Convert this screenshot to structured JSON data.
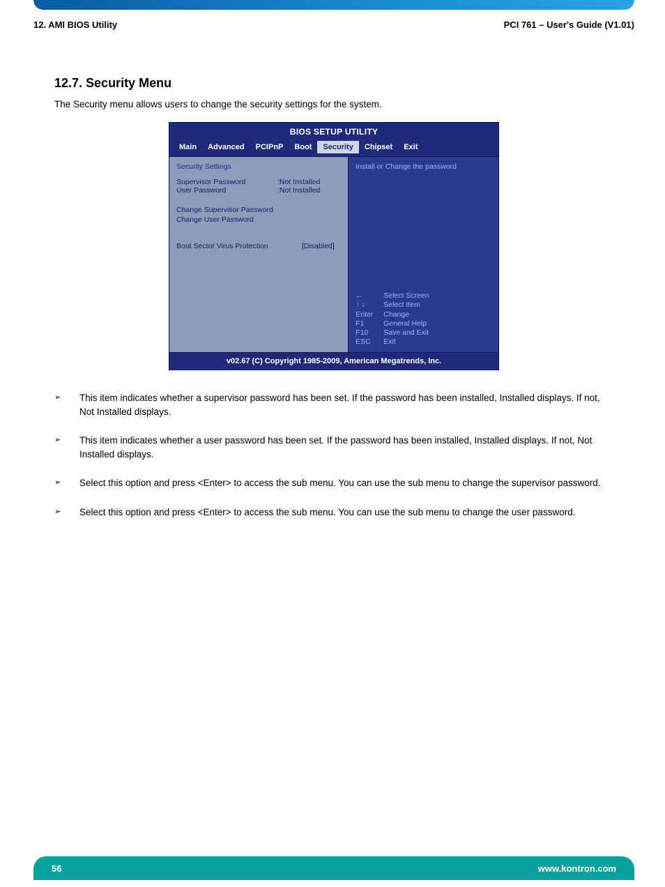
{
  "header": {
    "left": "12. AMI BIOS Utility",
    "right": "PCI 761 – User's Guide (V1.01)"
  },
  "section": {
    "title": "12.7. Security Menu",
    "intro": "The Security menu allows users to change the security settings for the system."
  },
  "bios": {
    "title": "BIOS SETUP UTILITY",
    "tabs": {
      "main": "Main",
      "advanced": "Advanced",
      "pcipnp": "PCIPnP",
      "boot": "Boot",
      "security": "Security",
      "chipset": "Chipset",
      "exit": "Exit"
    },
    "left": {
      "heading": "Security Settings",
      "supervisor_label": "Supervisor Password",
      "supervisor_value": ":Not Installed",
      "user_label": "User Password",
      "user_value": ":Not Installed",
      "change_sup": "Change Supervisor Password",
      "change_user": "Change User Password",
      "bootsector_label": "Boot Sector Virus Protection",
      "bootsector_value": "[Disabled]"
    },
    "right": {
      "help": "Install or Change the password",
      "keys": {
        "k1": "←",
        "v1": "Select Screen",
        "k2": "↑ ↓",
        "v2": "Select Item",
        "k3": "Enter",
        "v3": "Change",
        "k4": "F1",
        "v4": "General Help",
        "k5": "F10",
        "v5": "Save and Exit",
        "k6": "ESC",
        "v6": "Exit"
      }
    },
    "footer": "v02.67 (C) Copyright 1985-2009, American Megatrends, Inc."
  },
  "bullets": {
    "arrow": "➢",
    "b1": "This item indicates whether a supervisor password has been set. If the password has been installed, Installed displays. If not, Not Installed displays.",
    "b2": "This item indicates whether a user password has been set. If the password has been installed, Installed displays. If not, Not Installed displays.",
    "b3": "Select this option and press <Enter> to access the sub menu. You can use the sub menu to change the supervisor password.",
    "b4": "Select this option and press <Enter> to access the sub menu. You can use the sub menu to change the user password."
  },
  "footer": {
    "page": "56",
    "url": "www.kontron.com"
  }
}
